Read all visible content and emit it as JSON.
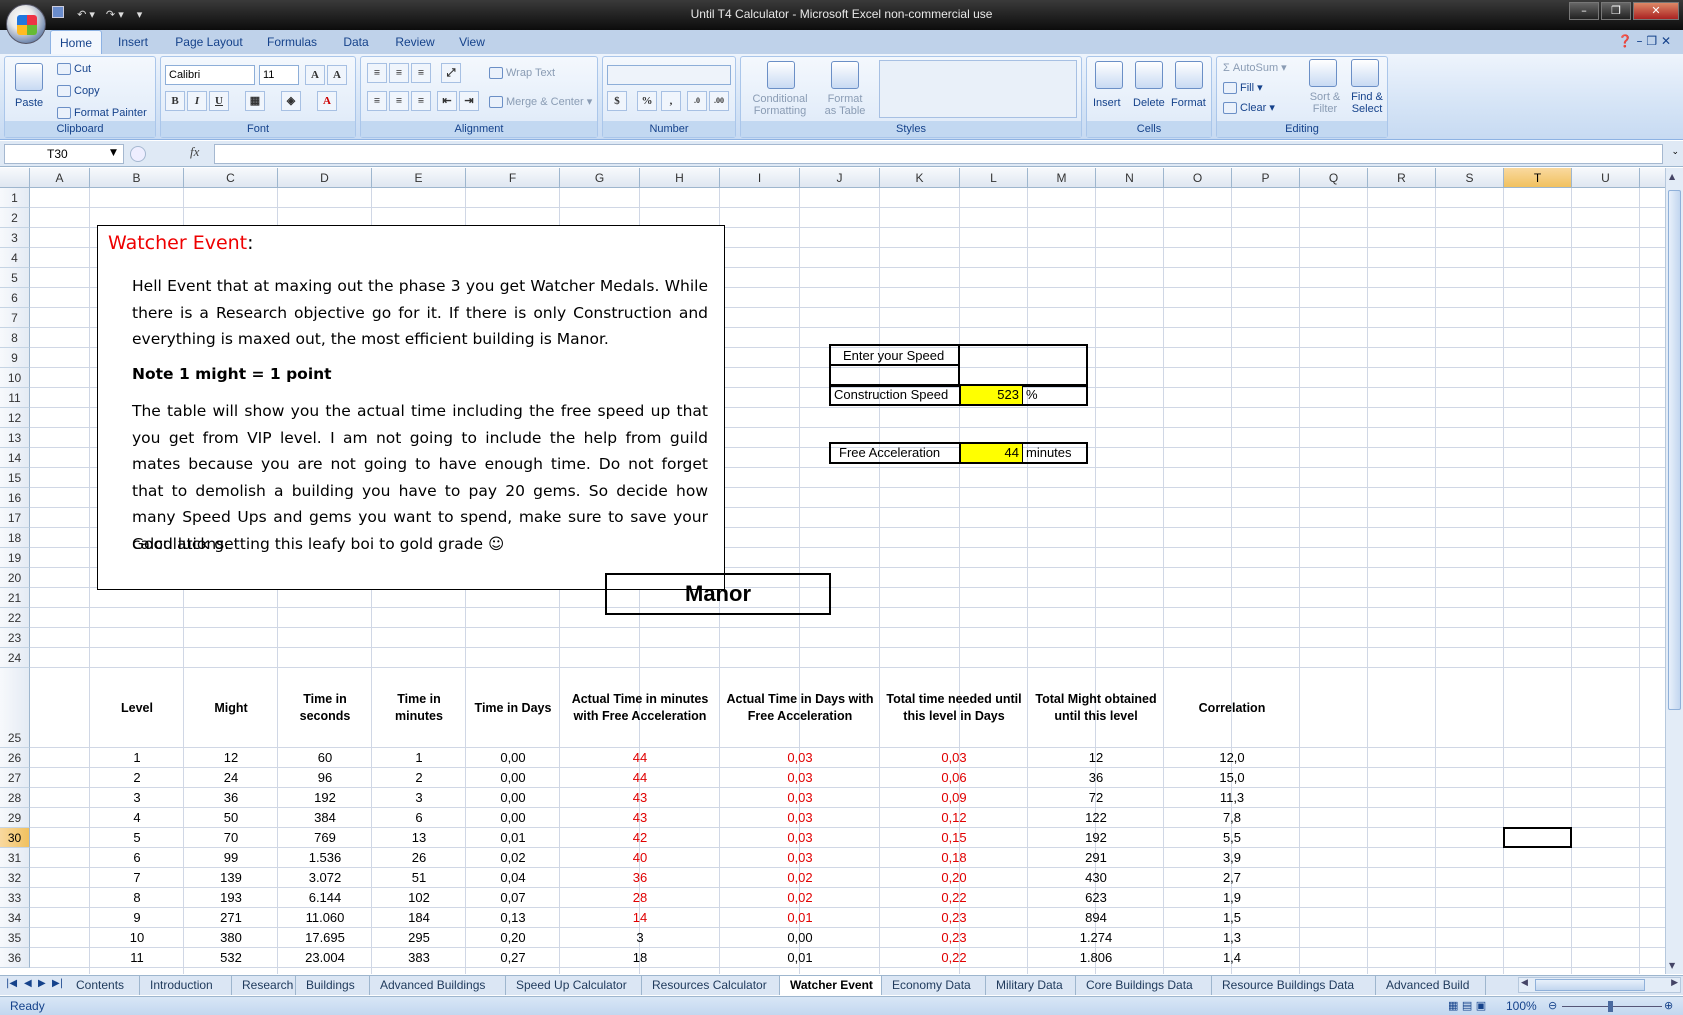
{
  "window": {
    "title": "Until T4 Calculator - Microsoft Excel non-commercial use"
  },
  "ribbon": {
    "tabs": [
      "Home",
      "Insert",
      "Page Layout",
      "Formulas",
      "Data",
      "Review",
      "View"
    ],
    "clipboard": {
      "paste": "Paste",
      "cut": "Cut",
      "copy": "Copy",
      "format_painter": "Format Painter",
      "label": "Clipboard"
    },
    "font": {
      "name": "Calibri",
      "size": "11",
      "label": "Font"
    },
    "alignment": {
      "wrap": "Wrap Text",
      "merge": "Merge & Center",
      "label": "Alignment"
    },
    "number": {
      "label": "Number"
    },
    "styles": {
      "conditional": "Conditional",
      "conditional2": "Formatting",
      "format_table": "Format",
      "format_table2": "as Table",
      "label": "Styles"
    },
    "cells": {
      "insert": "Insert",
      "delete": "Delete",
      "format": "Format",
      "label": "Cells"
    },
    "editing": {
      "autosum": "AutoSum",
      "fill": "Fill",
      "clear": "Clear",
      "sort": "Sort &",
      "sort2": "Filter",
      "find": "Find &",
      "find2": "Select",
      "label": "Editing"
    }
  },
  "formula_bar": {
    "name_box": "T30",
    "fx": "fx",
    "content": ""
  },
  "columns": [
    "A",
    "B",
    "C",
    "D",
    "E",
    "F",
    "G",
    "H",
    "I",
    "J",
    "K",
    "L",
    "M",
    "N",
    "O",
    "P",
    "Q",
    "R",
    "S",
    "T",
    "U",
    "V",
    "W"
  ],
  "rows": [
    "1",
    "2",
    "3",
    "4",
    "5",
    "6",
    "7",
    "8",
    "9",
    "10",
    "11",
    "12",
    "13",
    "14",
    "15",
    "16",
    "17",
    "18",
    "19",
    "20",
    "21",
    "22",
    "23",
    "24",
    "25",
    "26",
    "27",
    "28",
    "29",
    "30",
    "31",
    "32",
    "33",
    "34",
    "35",
    "36"
  ],
  "selected": {
    "col": "T",
    "row": "30"
  },
  "textbox": {
    "title": "Watcher Event",
    "title_colon": ":",
    "p1": "Hell Event that at maxing out the phase 3 you get Watcher Medals. While there is a Research objective go for it. If there is only Construction and everything is maxed out, the most efficient building is Manor.",
    "p2": "Note 1 might = 1 point",
    "p3": "The table will show you the actual time including the free speed up that you get from VIP level. I am not going to include the help from guild mates because you are not going to have enough time. Do not forget that to demolish a building you have to pay 20 gems. So decide how many Speed Ups and gems you want to spend, make sure to save your calculations.",
    "p4": "Good luck getting this leafy boi to gold grade ☺"
  },
  "speed_panel": {
    "enter_label": "Enter your Speed",
    "construction_label": "Construction Speed",
    "construction_value": "523",
    "construction_unit": "%",
    "accel_label": "Free Acceleration",
    "accel_value": "44",
    "accel_unit": "minutes",
    "highlight": "#ffff00"
  },
  "manor_title": "Manor",
  "table": {
    "headers": [
      "Level",
      "Might",
      "Time in seconds",
      "Time in minutes",
      "Time in Days",
      "Actual Time in minutes with Free Acceleration",
      "Actual Time in Days with Free Acceleration",
      "Total time needed until this level in Days",
      "Total Might obtained until this level",
      "Correlation"
    ],
    "rows": [
      [
        "1",
        "12",
        "60",
        "1",
        "0,00",
        "44",
        "0,03",
        "0,03",
        "12",
        "12,0"
      ],
      [
        "2",
        "24",
        "96",
        "2",
        "0,00",
        "44",
        "0,03",
        "0,06",
        "36",
        "15,0"
      ],
      [
        "3",
        "36",
        "192",
        "3",
        "0,00",
        "43",
        "0,03",
        "0,09",
        "72",
        "11,3"
      ],
      [
        "4",
        "50",
        "384",
        "6",
        "0,00",
        "43",
        "0,03",
        "0,12",
        "122",
        "7,8"
      ],
      [
        "5",
        "70",
        "769",
        "13",
        "0,01",
        "42",
        "0,03",
        "0,15",
        "192",
        "5,5"
      ],
      [
        "6",
        "99",
        "1.536",
        "26",
        "0,02",
        "40",
        "0,03",
        "0,18",
        "291",
        "3,9"
      ],
      [
        "7",
        "139",
        "3.072",
        "51",
        "0,04",
        "36",
        "0,02",
        "0,20",
        "430",
        "2,7"
      ],
      [
        "8",
        "193",
        "6.144",
        "102",
        "0,07",
        "28",
        "0,02",
        "0,22",
        "623",
        "1,9"
      ],
      [
        "9",
        "271",
        "11.060",
        "184",
        "0,13",
        "14",
        "0,01",
        "0,23",
        "894",
        "1,5"
      ],
      [
        "10",
        "380",
        "17.695",
        "295",
        "0,20",
        "3",
        "0,00",
        "0,23",
        "1.274",
        "1,3"
      ],
      [
        "11",
        "532",
        "23.004",
        "383",
        "0,27",
        "18",
        "0,01",
        "0,22",
        "1.806",
        "1,4"
      ]
    ],
    "red_cells": [
      [
        5,
        6,
        7
      ],
      [
        5,
        6,
        7
      ],
      [
        5,
        6,
        7
      ],
      [
        5,
        6,
        7
      ],
      [
        5,
        6,
        7
      ],
      [
        5,
        6,
        7
      ],
      [
        5,
        6,
        7
      ],
      [
        5,
        6,
        7
      ],
      [
        5,
        6,
        7
      ],
      [
        7
      ],
      [
        7
      ]
    ],
    "red_color": "#e00000"
  },
  "sheet_tabs": [
    "Contents",
    "Introduction",
    "Research",
    "Buildings",
    "Advanced Buildings",
    "Speed Up Calculator",
    "Resources Calculator",
    "Watcher Event",
    "Economy Data",
    "Military Data",
    "Core Buildings Data",
    "Resource Buildings Data",
    "Advanced Build"
  ],
  "active_tab": "Watcher Event",
  "status": {
    "ready": "Ready",
    "zoom": "100%"
  }
}
